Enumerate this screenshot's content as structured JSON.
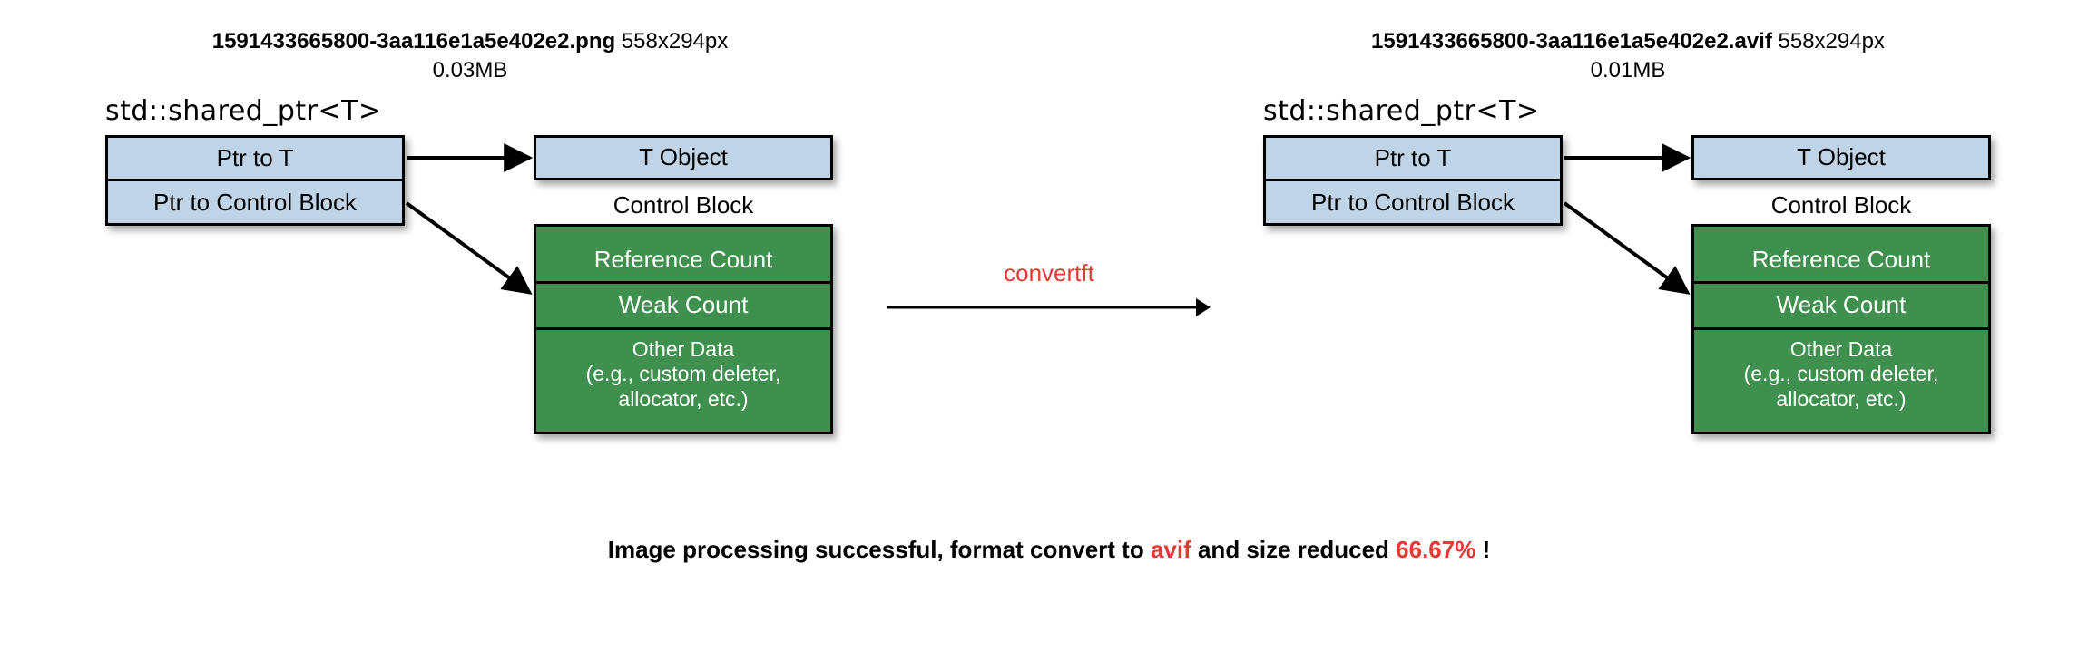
{
  "left": {
    "filename": "1591433665800-3aa116e1a5e402e2.png",
    "dimensions": "558x294px",
    "size": "0.03MB"
  },
  "right": {
    "filename": "1591433665800-3aa116e1a5e402e2.avif",
    "dimensions": "558x294px",
    "size": "0.01MB"
  },
  "convert_label": "convertft",
  "diagram": {
    "type_header": "std::shared_ptr<T>",
    "ptr_to_t": "Ptr to T",
    "ptr_to_ctrl": "Ptr to Control Block",
    "t_object": "T Object",
    "control_block_label": "Control Block",
    "ref_count": "Reference Count",
    "weak_count": "Weak Count",
    "other_data_l1": "Other Data",
    "other_data_l2": "(e.g., custom deleter,",
    "other_data_l3": "allocator, etc.)"
  },
  "result": {
    "prefix": "Image processing successful, format convert to ",
    "format": "avif",
    "mid": " and size reduced ",
    "pct": "66.67%",
    "suffix": " !"
  }
}
